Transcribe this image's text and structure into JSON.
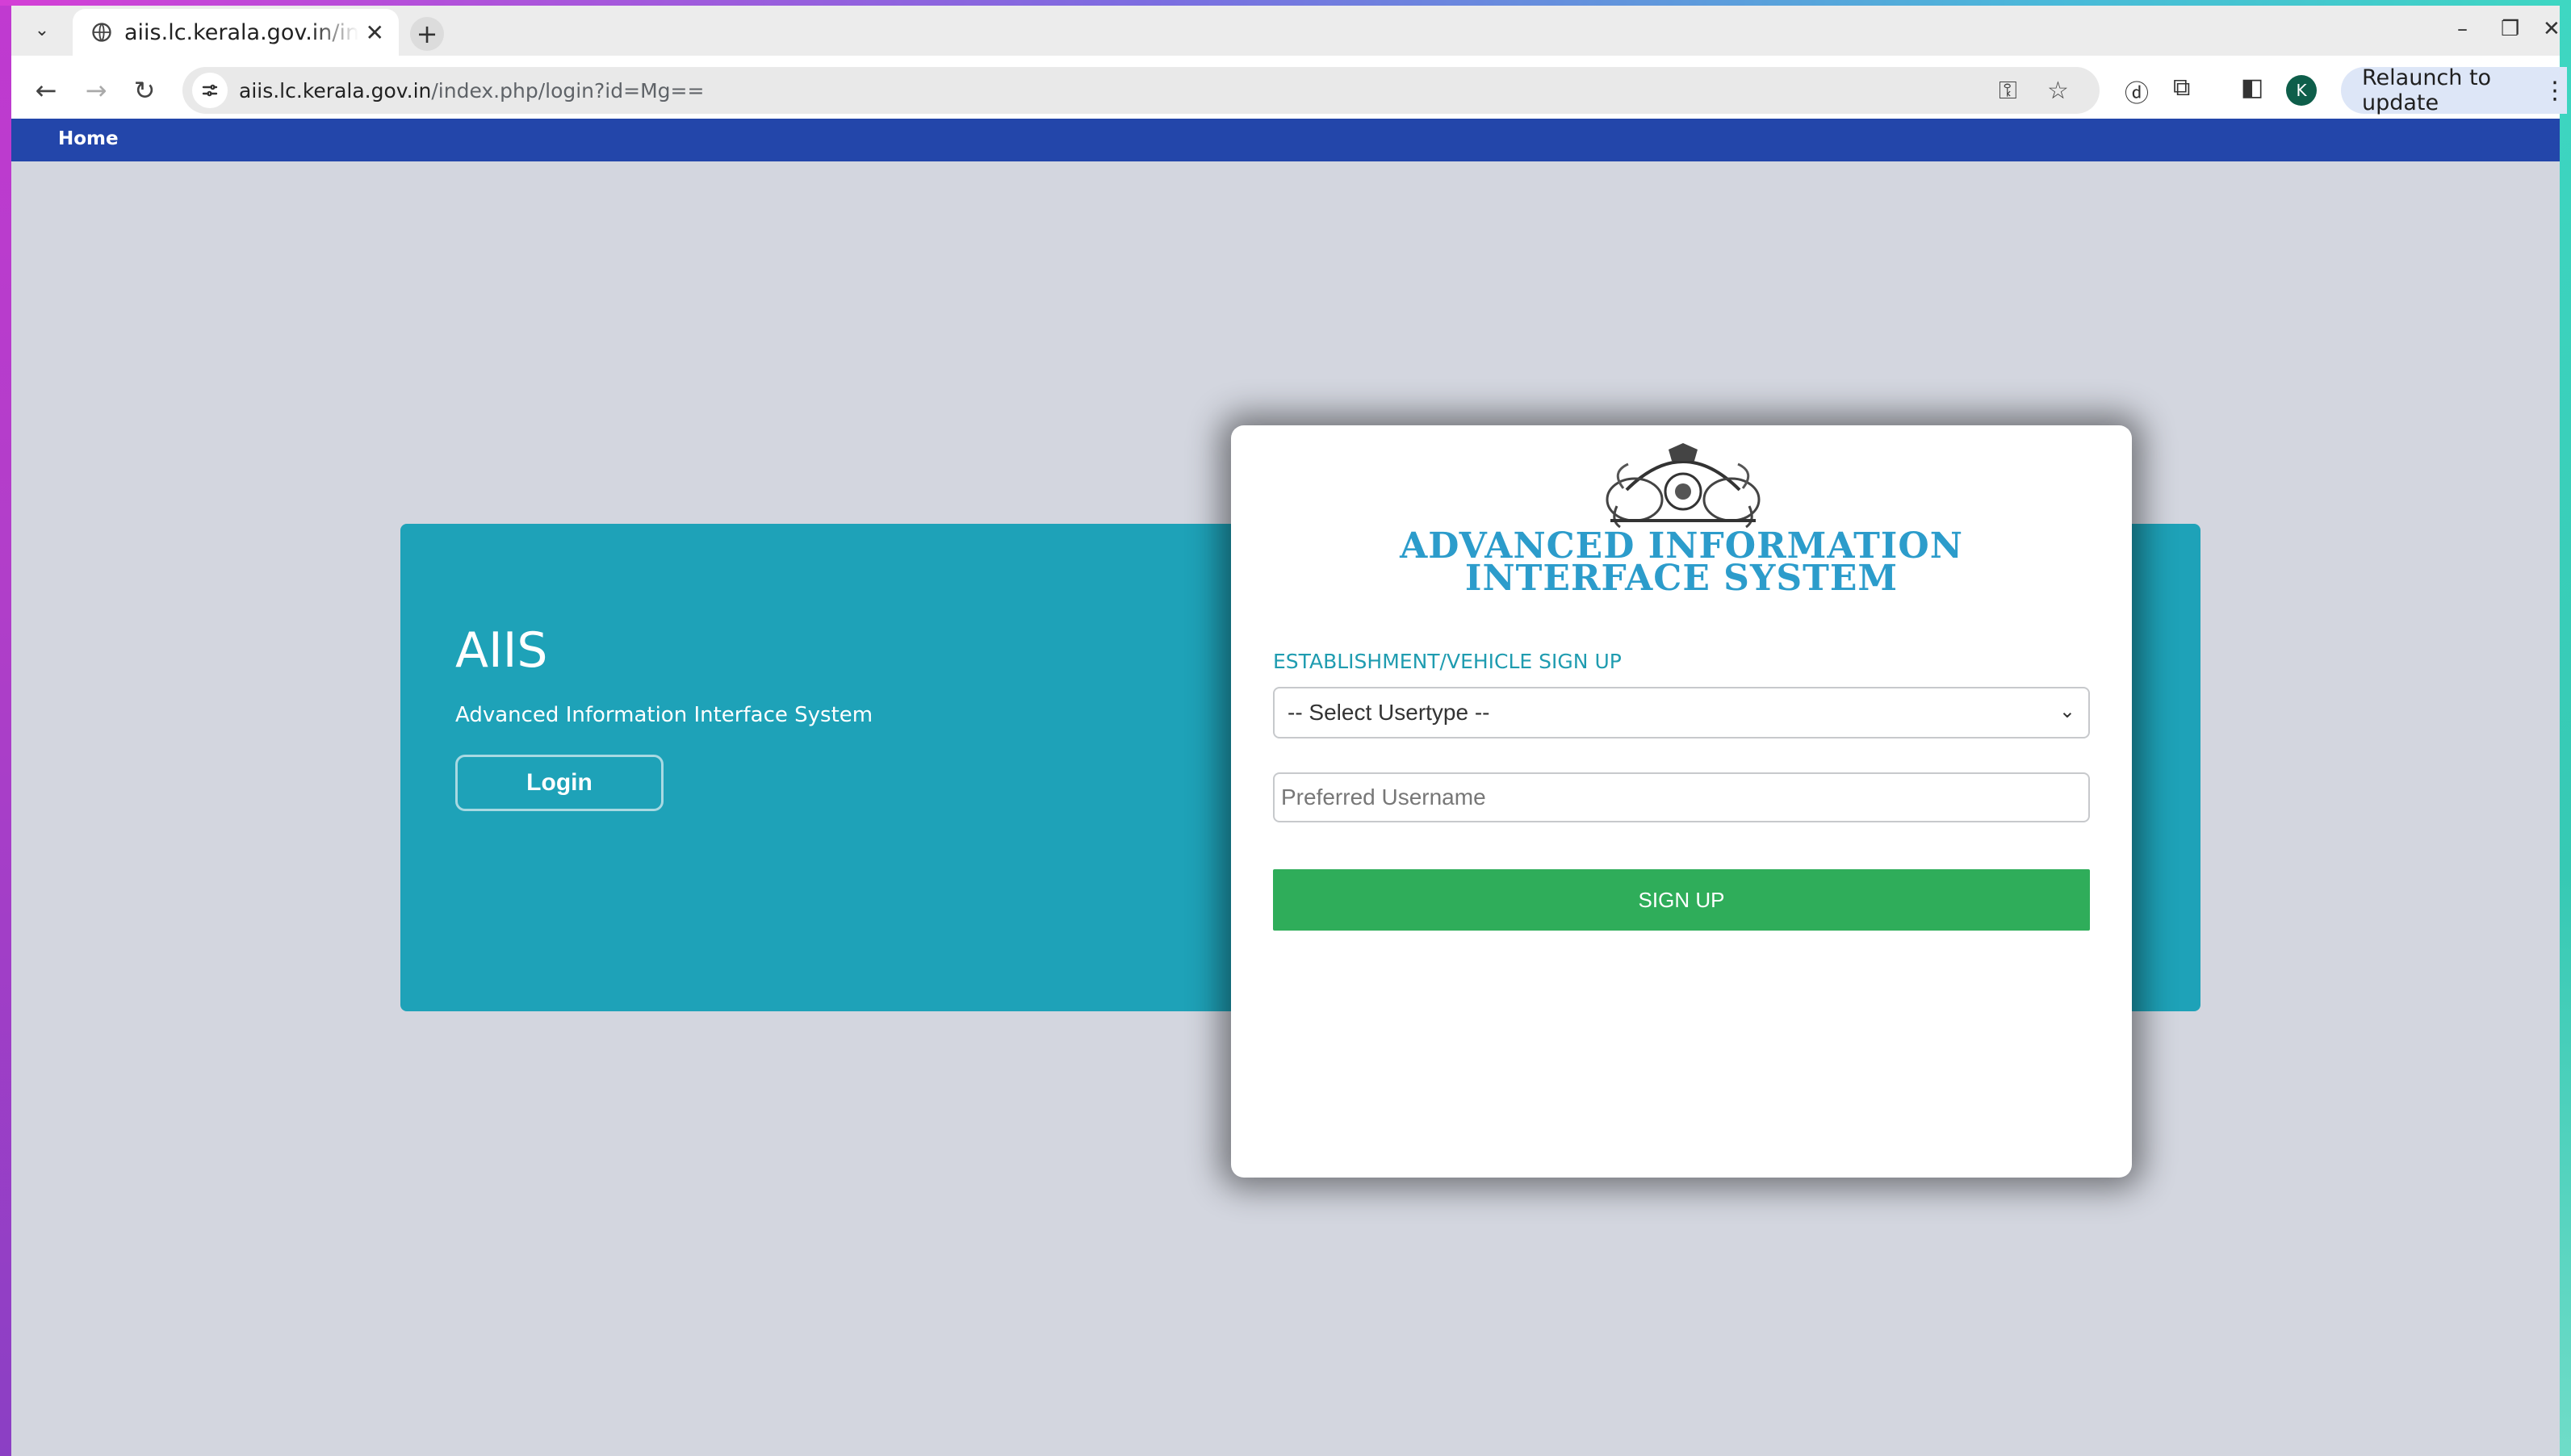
{
  "browser": {
    "tab_title": "aiis.lc.kerala.gov.in/index.php/login?id=Mg==",
    "url_host": "aiis.lc.kerala.gov.in",
    "url_path": "/index.php/login?id=Mg==",
    "avatar_letter": "K",
    "relaunch_label": "Relaunch to update"
  },
  "nav": {
    "home": "Home"
  },
  "hero": {
    "title": "AIIS",
    "subtitle": "Advanced Information Interface System",
    "login_label": "Login"
  },
  "card": {
    "logo_line1": "ADVANCED INFORMATION",
    "logo_line2": "INTERFACE SYSTEM",
    "heading": "ESTABLISHMENT/VEHICLE SIGN UP",
    "usertype_selected": "-- Select Usertype --",
    "username_placeholder": "Preferred Username",
    "signup_label": "SIGN UP"
  },
  "colors": {
    "nav_bar": "#2346aa",
    "hero_bg": "#1ea2b8",
    "signup_button": "#2fad5a",
    "logo_text": "#2c9ccb"
  }
}
